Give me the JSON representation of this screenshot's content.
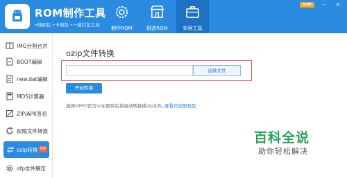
{
  "app": {
    "title": "ROM制作工具",
    "subtitle": "•线刷包 •卡刷包 •一键打包工具",
    "svip": "SVIP",
    "minimize": "–",
    "close": "×"
  },
  "nav": {
    "tabs": [
      {
        "label": "制作ROM",
        "icon": "gear-icon"
      },
      {
        "label": "挑选ROM",
        "icon": "store-icon"
      },
      {
        "label": "实用工具",
        "icon": "toolbox-icon",
        "active": true
      }
    ]
  },
  "sidebar": {
    "items": [
      {
        "label": "IMG分割合并",
        "icon": "split-icon"
      },
      {
        "label": "BOOT编辑",
        "icon": "boot-icon"
      },
      {
        "label": "new.dat编辑",
        "icon": "file-edit-icon"
      },
      {
        "label": "MD5计算器",
        "icon": "calculator-icon"
      },
      {
        "label": "ZIP/APK签名",
        "icon": "signature-icon"
      },
      {
        "label": "权限文件转换",
        "icon": "refresh-icon"
      },
      {
        "label": "ozip转换",
        "icon": "convert-icon",
        "active": true,
        "badge": "VIP"
      },
      {
        "label": "ofp文件解压",
        "icon": "gear-small-icon"
      }
    ]
  },
  "main": {
    "title": "ozip文件转换",
    "input_value": "",
    "choose_button": "选择文件",
    "start_button": "开始转换",
    "hint": "选择OPPO官方ozip固件后将自动转换成zip文件。",
    "hint_link": "查看已适配机型"
  },
  "watermark": {
    "title": "百科全说",
    "subtitle": "助你轻松解决"
  },
  "colors": {
    "header": "#2a8be0",
    "active_tab": "#1d72c3",
    "accent": "#2a8be0",
    "highlight": "#e05a5a",
    "watermark": "#23a35a"
  }
}
